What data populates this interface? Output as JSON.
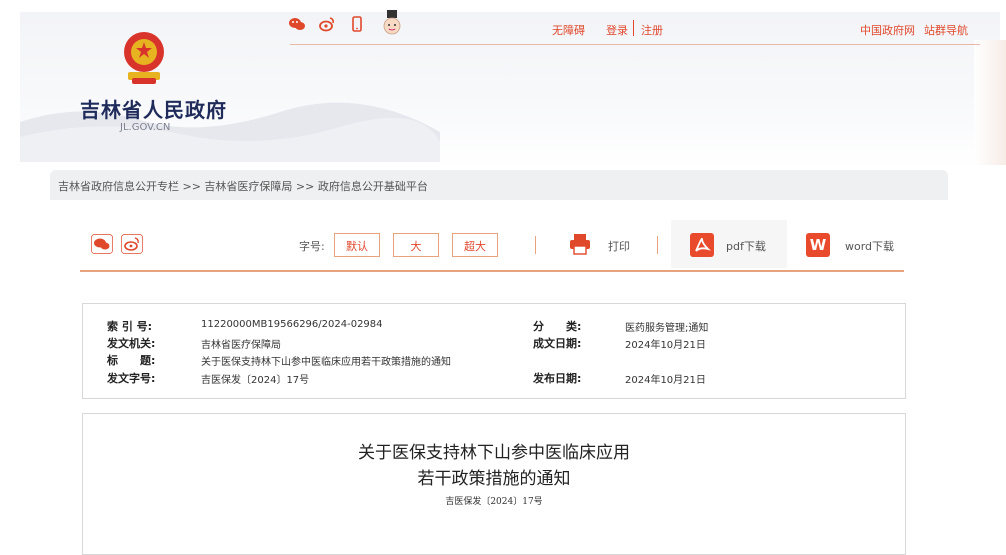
{
  "header": {
    "accessibility": "无障碍",
    "login": "登录",
    "register": "注册",
    "gov_site": "中国政府网",
    "site_nav": "站群导航",
    "site_name": "吉林省人民政府",
    "site_domain": "JL.GOV.CN"
  },
  "breadcrumb": "吉林省政府信息公开专栏 >> 吉林省医疗保障局 >> 政府信息公开基础平台",
  "toolbar": {
    "font_label": "字号:",
    "font_default": "默认",
    "font_large": "大",
    "font_xlarge": "超大",
    "print": "打印",
    "pdf": "pdf下载",
    "word_icon": "W",
    "word": "word下载"
  },
  "meta": {
    "index_k": "索 引 号:",
    "index_v": "11220000MB19566296/2024-02984",
    "category_k": "分　　类:",
    "category_v": "医药服务管理;通知",
    "issuer_k": "发文机关:",
    "issuer_v": "吉林省医疗保障局",
    "date_k": "成文日期:",
    "date_v": "2024年10月21日",
    "title_k": "标　　题:",
    "title_v": "关于医保支持林下山参中医临床应用若干政策措施的通知",
    "docno_k": "发文字号:",
    "docno_v": "吉医保发〔2024〕17号",
    "pubdate_k": "发布日期:",
    "pubdate_v": "2024年10月21日"
  },
  "document": {
    "title_line1": "关于医保支持林下山参中医临床应用",
    "title_line2": "若干政策措施的通知",
    "doc_number": "吉医保发〔2024〕17号"
  },
  "icons": [
    "wechat-icon",
    "weibo-icon",
    "mobile-icon",
    "mascot-icon",
    "emblem-icon",
    "print-icon",
    "pdf-icon",
    "word-icon"
  ],
  "colors": {
    "accent": "#e0482c",
    "title": "#1f2b5a",
    "border": "#e8a27e"
  }
}
